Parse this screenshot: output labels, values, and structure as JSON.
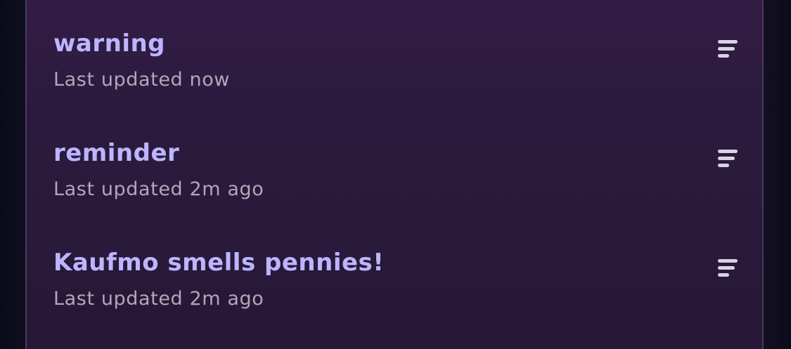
{
  "items": [
    {
      "title": "warning",
      "subtitle": "Last updated now"
    },
    {
      "title": "reminder",
      "subtitle": "Last updated 2m ago"
    },
    {
      "title": "Kaufmo smells pennies!",
      "subtitle": "Last updated 2m ago"
    }
  ],
  "icons": {
    "reorder": "drag-handle-icon"
  },
  "colors": {
    "title": "#bcb5ff",
    "subtitle": "#b3a6b9",
    "panel": "#2b1a3d",
    "icon": "#d9d3e6"
  }
}
